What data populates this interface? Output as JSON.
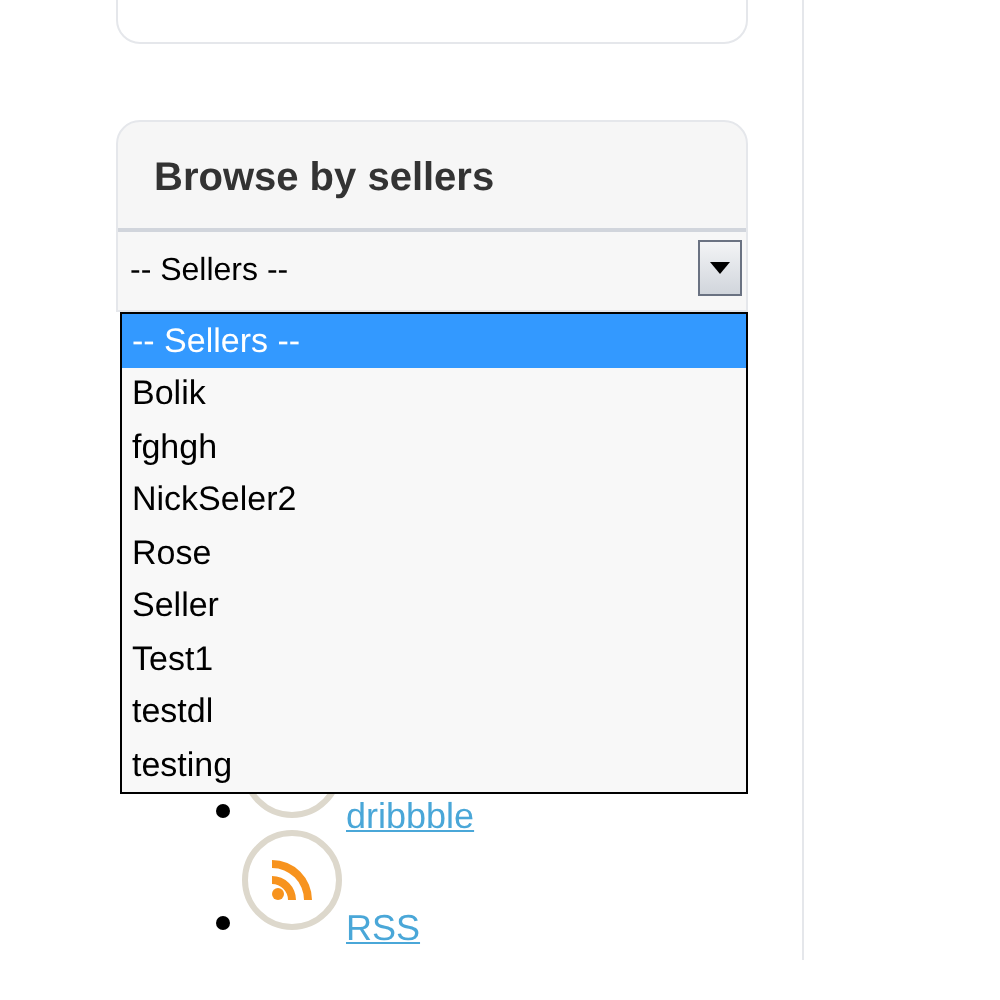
{
  "browse_sellers": {
    "title": "Browse by sellers",
    "select": {
      "value": "-- Sellers --",
      "expanded": true,
      "options": [
        {
          "label": "-- Sellers --",
          "selected": true
        },
        {
          "label": "Bolik",
          "selected": false
        },
        {
          "label": "fghgh",
          "selected": false
        },
        {
          "label": "NickSeler2",
          "selected": false
        },
        {
          "label": "Rose",
          "selected": false
        },
        {
          "label": "Seller",
          "selected": false
        },
        {
          "label": "Test1",
          "selected": false
        },
        {
          "label": "testdl",
          "selected": false
        },
        {
          "label": "testing",
          "selected": false
        }
      ]
    }
  },
  "social_links": [
    {
      "kind": "dribbble",
      "label": "dribbble"
    },
    {
      "kind": "rss",
      "label": "RSS"
    }
  ]
}
